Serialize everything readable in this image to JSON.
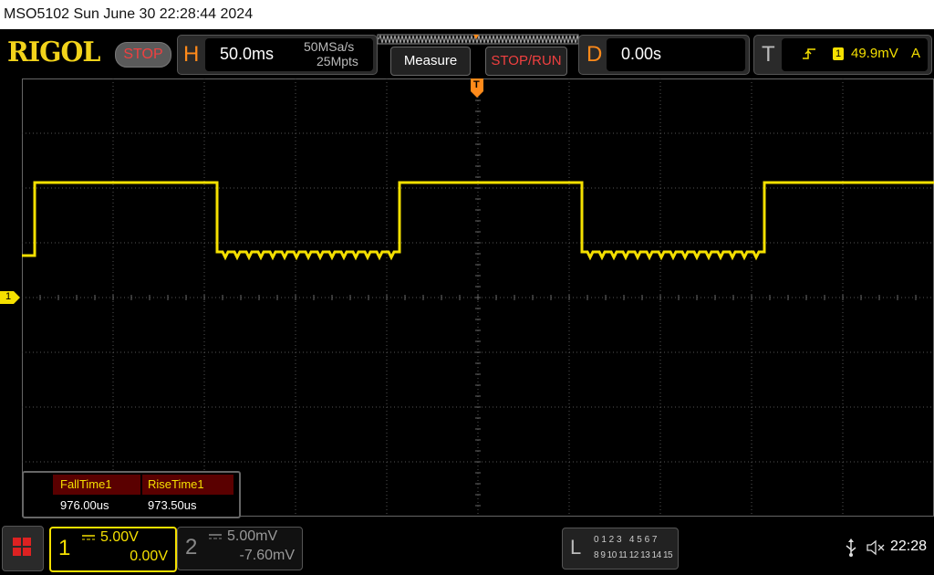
{
  "titlebar": {
    "text": "MSO5102  Sun June 30 22:28:44 2024"
  },
  "header": {
    "logo": "RIGOL",
    "run_state": "STOP",
    "horizontal": {
      "letter": "H",
      "timebase": "50.0ms",
      "sample_rate": "50MSa/s",
      "memory_depth": "25Mpts"
    },
    "measure_label": "Measure",
    "stop_run_label": "STOP/RUN",
    "delay": {
      "letter": "D",
      "value": "0.00s"
    },
    "trigger": {
      "letter": "T",
      "source": "1",
      "level": "49.9mV",
      "mode": "A"
    }
  },
  "waveform": {
    "channel_marker": "1",
    "trigger_marker": "T",
    "color": "#f5e000"
  },
  "measurements": {
    "headers": [
      "FallTime1",
      "RiseTime1"
    ],
    "values": [
      "976.00us",
      "973.50us"
    ]
  },
  "channels": [
    {
      "number": "1",
      "scale": "5.00V",
      "offset": "0.00V"
    },
    {
      "number": "2",
      "scale": "5.00mV",
      "offset": "-7.60mV"
    }
  ],
  "logic": {
    "letter": "L",
    "row1": "0 1 2 3   4 5 6 7",
    "row2": "8 9 10 11 12 13 14 15"
  },
  "status": {
    "time": "22:28"
  },
  "colors": {
    "accent": "#ff8a1a",
    "channel1": "#f5e000",
    "stop": "#f04040"
  }
}
